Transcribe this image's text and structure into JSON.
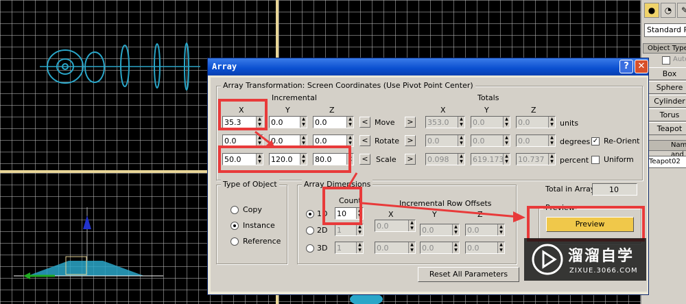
{
  "dialog": {
    "title": "Array",
    "help_label": "?",
    "close_label": "✕",
    "transformation": {
      "group_label": "Array Transformation: Screen Coordinates (Use Pivot Point Center)",
      "incremental_label": "Incremental",
      "totals_label": "Totals",
      "axis_x": "X",
      "axis_y": "Y",
      "axis_z": "Z",
      "rows": [
        {
          "label": "Move",
          "inc": [
            "35.3",
            "0.0",
            "0.0"
          ],
          "tot": [
            "353.0",
            "0.0",
            "0.0"
          ],
          "unit": "units"
        },
        {
          "label": "Rotate",
          "inc": [
            "0.0",
            "0.0",
            "0.0"
          ],
          "tot": [
            "0.0",
            "0.0",
            "0.0"
          ],
          "unit": "degrees"
        },
        {
          "label": "Scale",
          "inc": [
            "50.0",
            "120.0",
            "80.0"
          ],
          "tot": [
            "0.098",
            "619.173",
            "10.737"
          ],
          "unit": "percent"
        }
      ],
      "left_arrow": "<",
      "right_arrow": ">",
      "re_orient_label": "Re-Orient",
      "re_orient_checked": true,
      "uniform_label": "Uniform",
      "uniform_checked": false
    },
    "type_of_object": {
      "group_label": "Type of Object",
      "options": [
        "Copy",
        "Instance",
        "Reference"
      ],
      "selected": "Instance"
    },
    "dimensions": {
      "group_label": "Array Dimensions",
      "count_label": "Count",
      "offsets_label": "Incremental Row Offsets",
      "axis_x": "X",
      "axis_y": "Y",
      "axis_z": "Z",
      "rows": [
        {
          "label": "1D",
          "count": "10"
        },
        {
          "label": "2D",
          "count": "1",
          "offsets": [
            "0.0",
            "0.0",
            "0.0"
          ]
        },
        {
          "label": "3D",
          "count": "1",
          "offsets": [
            "0.0",
            "0.0",
            "0.0"
          ]
        }
      ],
      "offsets_1d": [
        "0.0",
        "0.0",
        "0.0"
      ]
    },
    "total_label": "Total in Array:",
    "total_value": "10",
    "preview_group_label": "Preview",
    "preview_button": "Preview",
    "reset_button": "Reset All Parameters"
  },
  "command_panel": {
    "object_type_dropdown": "Standard Primitives",
    "rollout_title": "Object Type",
    "autogrid_label": "AutoGrid",
    "buttons": [
      "Box",
      "Sphere",
      "Cylinder",
      "Torus",
      "Teapot"
    ],
    "name_rollout": "Name and Color",
    "name_value": "Teapot02"
  },
  "watermark": {
    "brand": "溜溜自学",
    "url": "ZIXUE.3066.COM"
  },
  "colors": {
    "annotation_red": "#e83a3a",
    "preview_button": "#f0c84a",
    "object_teal": "#2aa6c8"
  }
}
